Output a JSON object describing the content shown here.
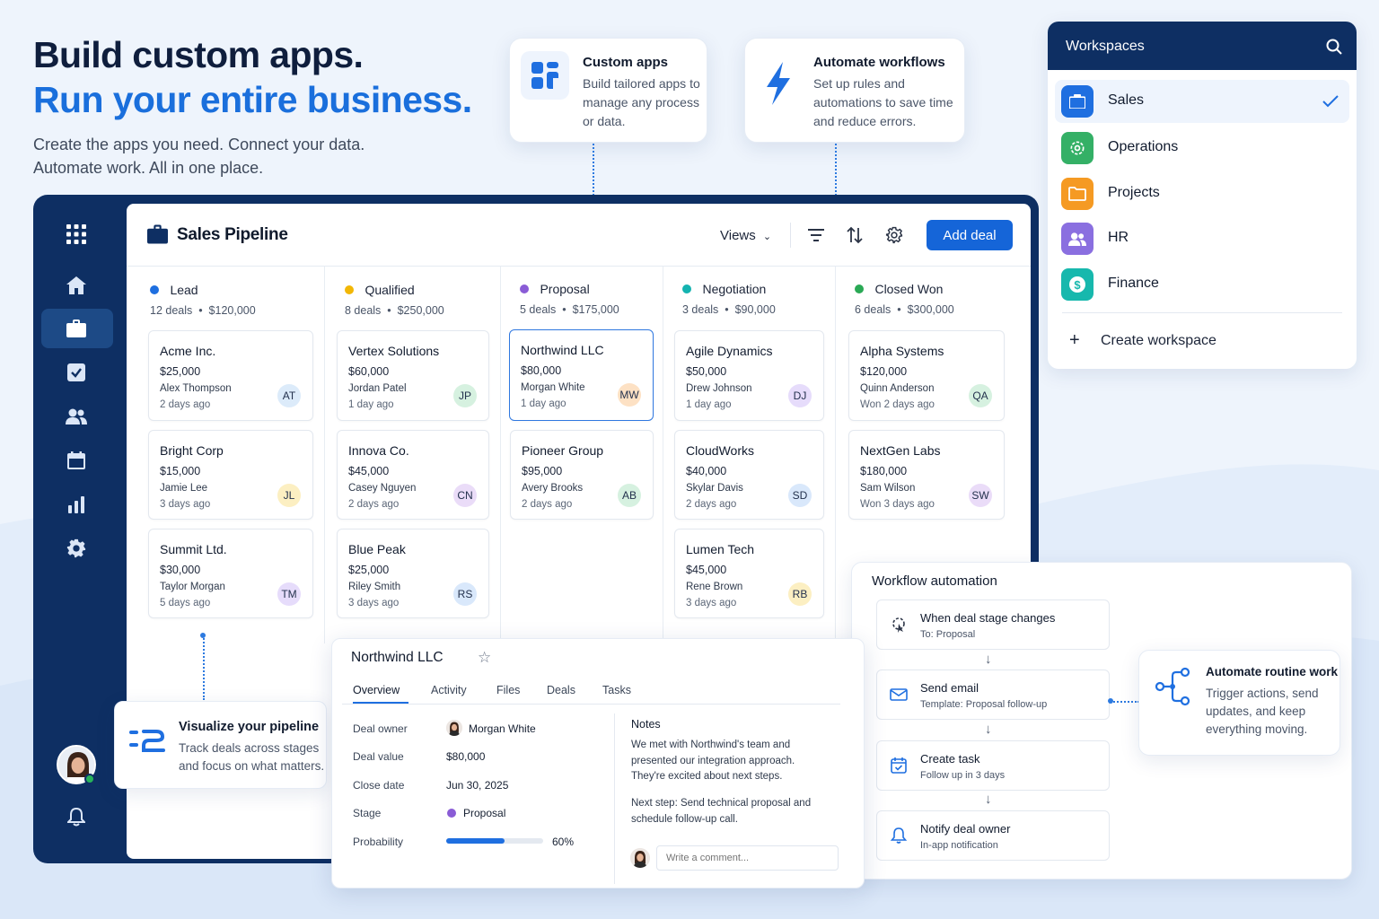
{
  "hero": {
    "line1": "Build custom apps.",
    "line2": "Run your entire business.",
    "subtitle": "Create the apps you need. Connect your data. Automate work. All in one place."
  },
  "callouts": {
    "custom_apps": {
      "title": "Custom apps",
      "text": "Build tailored apps to manage any process or data."
    },
    "automate": {
      "title": "Automate workflows",
      "text": "Set up rules and automations to save time and reduce errors."
    },
    "visualize": {
      "title": "Visualize your pipeline",
      "text": "Track deals across stages and focus on what matters."
    },
    "routine": {
      "title": "Automate routine work",
      "text": "Trigger actions, send updates, and keep everything moving."
    }
  },
  "sidebar": {
    "icons": [
      "apps-grid-icon",
      "home-icon",
      "briefcase-icon",
      "checkbox-icon",
      "users-icon",
      "calendar-icon",
      "bar-chart-icon",
      "gear-icon"
    ],
    "active": "briefcase-icon"
  },
  "header": {
    "title": "Sales Pipeline",
    "views_label": "Views",
    "add_deal_label": "Add deal"
  },
  "columns": [
    {
      "name": "Lead",
      "color": "#1e6fe0",
      "deals": "12 deals",
      "total": "$120,000",
      "cards": [
        {
          "company": "Acme Inc.",
          "value": "$25,000",
          "person": "Alex Thompson",
          "time": "2 days ago",
          "initials": "AT",
          "avatar": "#dcebfa"
        },
        {
          "company": "Bright Corp",
          "value": "$15,000",
          "person": "Jamie Lee",
          "time": "3 days ago",
          "initials": "JL",
          "avatar": "#fcefc2"
        },
        {
          "company": "Summit Ltd.",
          "value": "$30,000",
          "person": "Taylor Morgan",
          "time": "5 days ago",
          "initials": "TM",
          "avatar": "#e6dcfb"
        }
      ]
    },
    {
      "name": "Qualified",
      "color": "#f2b705",
      "deals": "8 deals",
      "total": "$250,000",
      "cards": [
        {
          "company": "Vertex Solutions",
          "value": "$60,000",
          "person": "Jordan Patel",
          "time": "1 day ago",
          "initials": "JP",
          "avatar": "#d6f1e0"
        },
        {
          "company": "Innova Co.",
          "value": "$45,000",
          "person": "Casey Nguyen",
          "time": "2 days ago",
          "initials": "CN",
          "avatar": "#eadcf8"
        },
        {
          "company": "Blue Peak",
          "value": "$25,000",
          "person": "Riley Smith",
          "time": "3 days ago",
          "initials": "RS",
          "avatar": "#d9e8fb"
        }
      ]
    },
    {
      "name": "Proposal",
      "color": "#8a5cd6",
      "deals": "5 deals",
      "total": "$175,000",
      "cards": [
        {
          "company": "Northwind LLC",
          "value": "$80,000",
          "person": "Morgan White",
          "time": "1 day ago",
          "initials": "MW",
          "avatar": "#fde1c4"
        },
        {
          "company": "Pioneer Group",
          "value": "$95,000",
          "person": "Avery Brooks",
          "time": "2 days ago",
          "initials": "AB",
          "avatar": "#d6f1e0"
        }
      ]
    },
    {
      "name": "Negotiation",
      "color": "#14b3b0",
      "deals": "3 deals",
      "total": "$90,000",
      "cards": [
        {
          "company": "Agile Dynamics",
          "value": "$50,000",
          "person": "Drew Johnson",
          "time": "1 day ago",
          "initials": "DJ",
          "avatar": "#e6dcfb"
        },
        {
          "company": "CloudWorks",
          "value": "$40,000",
          "person": "Skylar Davis",
          "time": "2 days ago",
          "initials": "SD",
          "avatar": "#d9e8fb"
        },
        {
          "company": "Lumen Tech",
          "value": "$45,000",
          "person": "Rene Brown",
          "time": "3 days ago",
          "initials": "RB",
          "avatar": "#fcefc2"
        }
      ]
    },
    {
      "name": "Closed Won",
      "color": "#2aa955",
      "deals": "6 deals",
      "total": "$300,000",
      "cards": [
        {
          "company": "Alpha Systems",
          "value": "$120,000",
          "person": "Quinn Anderson",
          "time": "Won 2 days ago",
          "initials": "QA",
          "avatar": "#d6f1e0"
        },
        {
          "company": "NextGen Labs",
          "value": "$180,000",
          "person": "Sam Wilson",
          "time": "Won 3 days ago",
          "initials": "SW",
          "avatar": "#eadcf8"
        }
      ]
    }
  ],
  "workspaces": {
    "title": "Workspaces",
    "items": [
      {
        "label": "Sales",
        "color": "#1f6fe0",
        "icon": "briefcase-icon",
        "selected": true
      },
      {
        "label": "Operations",
        "color": "#34b066",
        "icon": "gear-icon",
        "selected": false
      },
      {
        "label": "Projects",
        "color": "#f59a23",
        "icon": "folder-icon",
        "selected": false
      },
      {
        "label": "HR",
        "color": "#8a6fe0",
        "icon": "users-icon",
        "selected": false
      },
      {
        "label": "Finance",
        "color": "#17b8ad",
        "icon": "dollar-icon",
        "selected": false
      }
    ],
    "create_label": "Create workspace"
  },
  "detail": {
    "title": "Northwind LLC",
    "tabs": [
      "Overview",
      "Activity",
      "Files",
      "Deals",
      "Tasks"
    ],
    "active_tab": "Overview",
    "fields": {
      "owner_label": "Deal owner",
      "owner": "Morgan White",
      "value_label": "Deal value",
      "value": "$80,000",
      "close_label": "Close date",
      "close": "Jun 30, 2025",
      "stage_label": "Stage",
      "stage": "Proposal",
      "prob_label": "Probability",
      "prob": "60%",
      "prob_fraction": 0.6
    },
    "notes_title": "Notes",
    "notes_p1": "We met with Northwind's team and presented our integration approach. They're excited about next steps.",
    "notes_p2": "Next step: Send technical proposal and schedule follow-up call.",
    "comment_placeholder": "Write a comment..."
  },
  "workflow": {
    "title": "Workflow automation",
    "steps": [
      {
        "title": "When deal stage changes",
        "sub": "To: Proposal"
      },
      {
        "title": "Send email",
        "sub": "Template: Proposal follow-up"
      },
      {
        "title": "Create task",
        "sub": "Follow up in 3 days"
      },
      {
        "title": "Notify deal owner",
        "sub": "In-app notification"
      }
    ]
  }
}
